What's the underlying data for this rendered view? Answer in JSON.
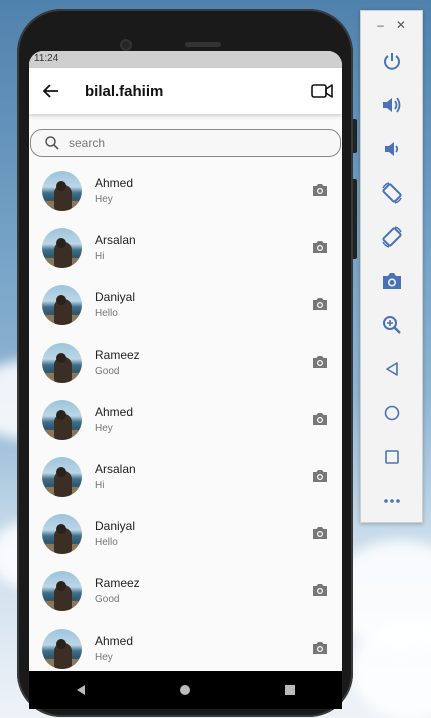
{
  "status_bar": {
    "time": "11:24"
  },
  "app_bar": {
    "title": "bilal.fahiim"
  },
  "search": {
    "placeholder": "search",
    "value": ""
  },
  "chats": [
    {
      "name": "Ahmed",
      "message": "Hey"
    },
    {
      "name": "Arsalan",
      "message": "Hi"
    },
    {
      "name": "Daniyal",
      "message": "Hello"
    },
    {
      "name": "Rameez",
      "message": "Good"
    },
    {
      "name": "Ahmed",
      "message": "Hey"
    },
    {
      "name": "Arsalan",
      "message": "Hi"
    },
    {
      "name": "Daniyal",
      "message": "Hello"
    },
    {
      "name": "Rameez",
      "message": "Good"
    },
    {
      "name": "Ahmed",
      "message": "Hey"
    }
  ],
  "emulator_toolbar": {
    "window_controls": [
      "minimize",
      "close"
    ],
    "buttons": [
      "power",
      "volume-up",
      "volume-down",
      "rotate-left",
      "rotate-right",
      "screenshot",
      "zoom",
      "back",
      "home",
      "overview",
      "more"
    ]
  },
  "colors": {
    "accent": "#3b6fb5",
    "toolbar_icon": "#4a72b8"
  }
}
